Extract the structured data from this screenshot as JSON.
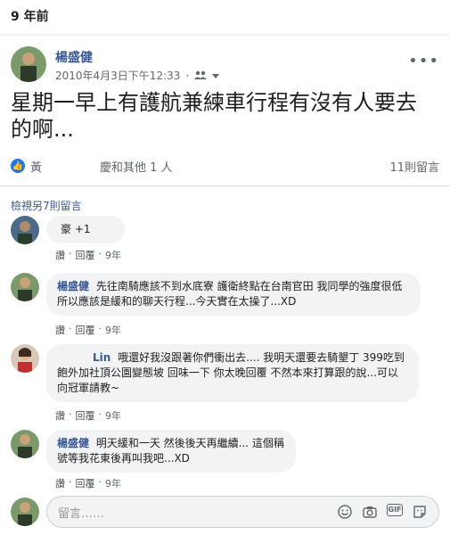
{
  "memory": {
    "label": "9 年前"
  },
  "post": {
    "author": "楊盛健",
    "timestamp": "2010年4月3日下午12:33",
    "audience_icon": "friends-icon",
    "body": "星期一早上有護航兼練車行程有沒有人要去的啊...",
    "reactions": {
      "summary": "黃　　　　　慶和其他 1 人",
      "comment_count": "11則留言"
    }
  },
  "comments_section": {
    "view_more": "檢視另7則留言",
    "comments": [
      {
        "name": "",
        "text": "豪 +1",
        "like": "讚",
        "reply": "回覆",
        "time": "9年"
      },
      {
        "name": "楊盛健",
        "text": "先往南騎應該不到水底寮 護衛終點在台南官田 我同學的強度很低所以應該是緩和的聊天行程...今天實在太操了...XD",
        "like": "讚",
        "reply": "回覆",
        "time": "9年"
      },
      {
        "name": "Lin",
        "text": "哦還好我沒跟著你們衝出去.... 我明天還要去騎墾丁 399吃到飽外加社頂公園變態坡 回味一下 你太晚回覆 不然本來打算跟的說...可以向冠軍請教~",
        "like": "讚",
        "reply": "回覆",
        "time": "9年"
      },
      {
        "name": "楊盛健",
        "text": "明天緩和一天 然後後天再繼續... 這個稱號等我花東後再叫我吧...XD",
        "like": "讚",
        "reply": "回覆",
        "time": "9年"
      }
    ]
  },
  "composer": {
    "placeholder": "留言……"
  },
  "colors": {
    "link": "#385898",
    "like_blue": "#1877f2",
    "bubble": "#f2f3f5"
  }
}
